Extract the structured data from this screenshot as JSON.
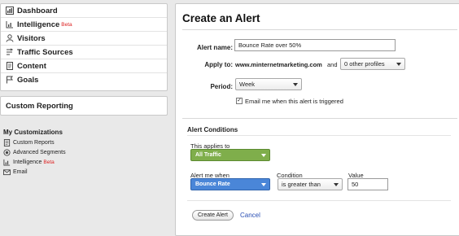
{
  "sidebar": {
    "nav": [
      {
        "label": "Dashboard",
        "icon": "dashboard-icon",
        "badge": ""
      },
      {
        "label": "Intelligence",
        "icon": "intelligence-icon",
        "badge": "Beta"
      },
      {
        "label": "Visitors",
        "icon": "person-icon",
        "badge": ""
      },
      {
        "label": "Traffic Sources",
        "icon": "traffic-icon",
        "badge": ""
      },
      {
        "label": "Content",
        "icon": "document-icon",
        "badge": ""
      },
      {
        "label": "Goals",
        "icon": "flag-icon",
        "badge": ""
      }
    ],
    "custom_reporting": "Custom Reporting",
    "my_customizations": {
      "title": "My Customizations",
      "items": [
        {
          "label": "Custom Reports",
          "icon": "report-icon",
          "badge": ""
        },
        {
          "label": "Advanced Segments",
          "icon": "segments-icon",
          "badge": ""
        },
        {
          "label": "Intelligence",
          "icon": "intelligence-icon",
          "badge": "Beta"
        },
        {
          "label": "Email",
          "icon": "email-icon",
          "badge": ""
        }
      ]
    }
  },
  "form": {
    "title": "Create an Alert",
    "alert_name_label": "Alert name:",
    "alert_name_value": "Bounce Rate over 50%",
    "apply_to_label": "Apply to:",
    "apply_to_site": "www.minternetmarketing.com",
    "apply_to_and": "and",
    "profiles_select": "0 other profiles",
    "period_label": "Period:",
    "period_value": "Week",
    "email_checkbox_label": "Email me when this alert is triggered",
    "email_checked": true,
    "conditions_title": "Alert Conditions",
    "applies_to_label": "This applies to",
    "applies_to_value": "All Traffic",
    "alert_when_label": "Alert me when",
    "alert_when_value": "Bounce Rate",
    "condition_label": "Condition",
    "condition_value": "is greater than",
    "value_label": "Value",
    "value_value": "50",
    "create_button": "Create Alert",
    "cancel_link": "Cancel"
  },
  "colors": {
    "green_select": "#7fae4b",
    "blue_select": "#4a86d8",
    "beta_red": "#dd2222",
    "link_blue": "#2a4fb4"
  }
}
